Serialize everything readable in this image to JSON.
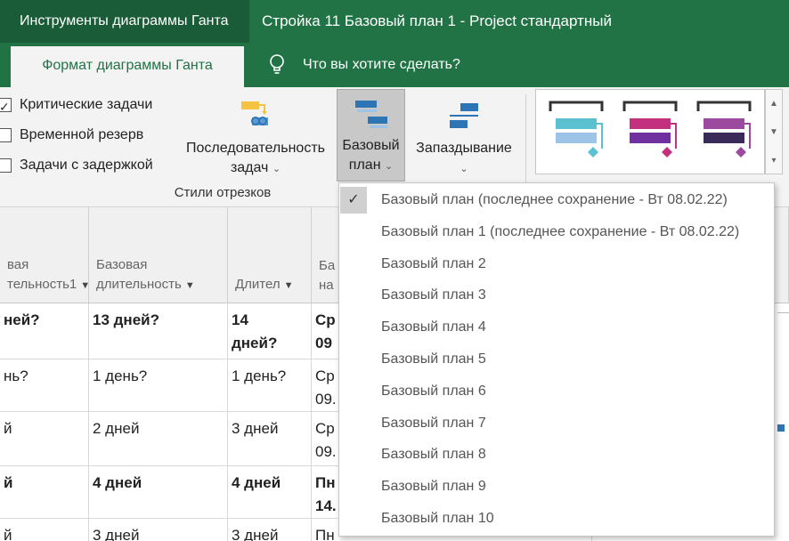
{
  "titlebar": {
    "tools_label": "Инструменты диаграммы Ганта",
    "doc_title": "Стройка 11 Базовый план 1  -  Project стандартный"
  },
  "tabs": {
    "active": "Формат диаграммы Ганта",
    "tell_me": "Что вы хотите сделать?"
  },
  "ribbon": {
    "checkboxes": [
      {
        "label": "Критические задачи",
        "checked": true
      },
      {
        "label": "Временной резерв",
        "checked": false
      },
      {
        "label": "Задачи с задержкой",
        "checked": false
      }
    ],
    "sequence_line1": "Последовательность",
    "sequence_line2": "задач",
    "baseline_line1": "Базовый",
    "baseline_line2": "план",
    "slippage": "Запаздывание",
    "group_label": "Стили отрезков",
    "gallery_colors": [
      "#5bc0cf",
      "#c2307e",
      "#9b4aa0"
    ]
  },
  "grid": {
    "headers": [
      {
        "line1": "вая",
        "line2": "тельность1"
      },
      {
        "line1": "Базовая",
        "line2": "длительность"
      },
      {
        "line1": "",
        "line2": "Длител"
      },
      {
        "line1": "Ба",
        "line2": "на"
      }
    ],
    "rows": [
      {
        "c0": "ней?",
        "c1": "13 дней?",
        "c2a": "14",
        "c2b": "дней?",
        "c3a": "Ср",
        "c3b": "09",
        "bold": true
      },
      {
        "c0": "нь?",
        "c1": "1 день?",
        "c2a": "1 день?",
        "c2b": "",
        "c3a": "Ср",
        "c3b": "09.",
        "bold": false
      },
      {
        "c0": "й",
        "c1": "2 дней",
        "c2a": "3 дней",
        "c2b": "",
        "c3a": "Ср",
        "c3b": "09.",
        "bold": false
      },
      {
        "c0": "й",
        "c1": "4 дней",
        "c2a": "4 дней",
        "c2b": "",
        "c3a": "Пн",
        "c3b": "14.",
        "bold": true
      },
      {
        "c0": "й",
        "c1": "3 дней",
        "c2a": "3 дней",
        "c2b": "",
        "c3a": "Пн",
        "c3b": "",
        "bold": false
      }
    ]
  },
  "menu": {
    "items": [
      {
        "label": "Базовый план (последнее сохранение - Вт 08.02.22)",
        "checked": true
      },
      {
        "label": "Базовый план 1 (последнее сохранение - Вт 08.02.22)",
        "checked": false
      },
      {
        "label": "Базовый план 2",
        "checked": false
      },
      {
        "label": "Базовый план 3",
        "checked": false
      },
      {
        "label": "Базовый план 4",
        "checked": false
      },
      {
        "label": "Базовый план 5",
        "checked": false
      },
      {
        "label": "Базовый план 6",
        "checked": false
      },
      {
        "label": "Базовый план 7",
        "checked": false
      },
      {
        "label": "Базовый план 8",
        "checked": false
      },
      {
        "label": "Базовый план 9",
        "checked": false
      },
      {
        "label": "Базовый план 10",
        "checked": false
      }
    ]
  },
  "icons": {
    "check": "✓",
    "caret": "⌄"
  }
}
